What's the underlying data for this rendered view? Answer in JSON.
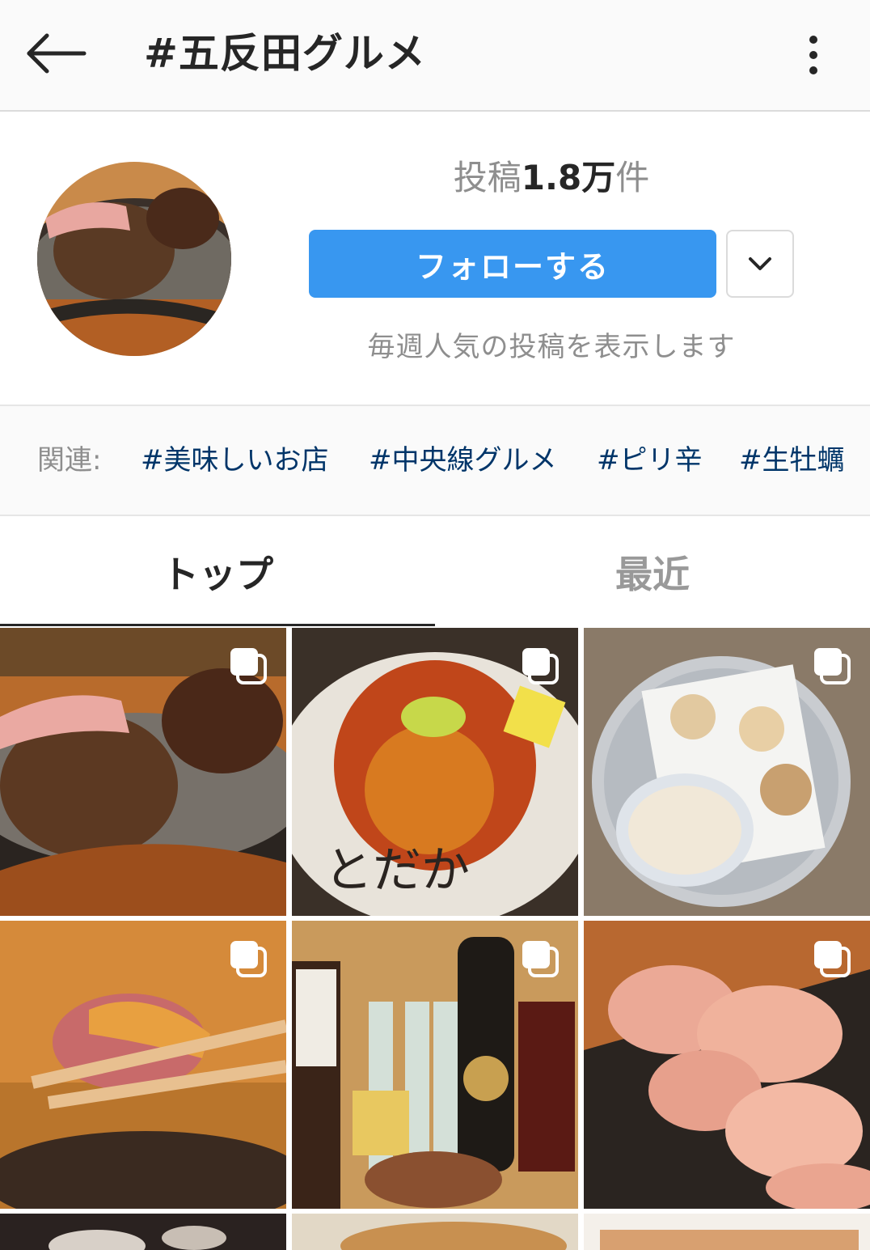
{
  "header": {
    "title": "#五反田グルメ"
  },
  "profile": {
    "posts_prefix": "投稿",
    "posts_count": "1.8万",
    "posts_suffix": "件",
    "follow_label": "フォローする",
    "weekly_note": "毎週人気の投稿を表示します"
  },
  "related": {
    "label": "関連:",
    "tags": [
      "#美味しいお店",
      "#中央線グルメ",
      "#ピリ辛",
      "#生牡蠣"
    ]
  },
  "tabs": {
    "top": "トップ",
    "recent": "最近",
    "active": "top"
  },
  "icons": {
    "back": "arrow-left-icon",
    "more": "more-vertical-icon",
    "dropdown": "chevron-down-icon",
    "multi": "multiple-photos-icon"
  },
  "colors": {
    "accent": "#3897f0",
    "link": "#003569"
  }
}
